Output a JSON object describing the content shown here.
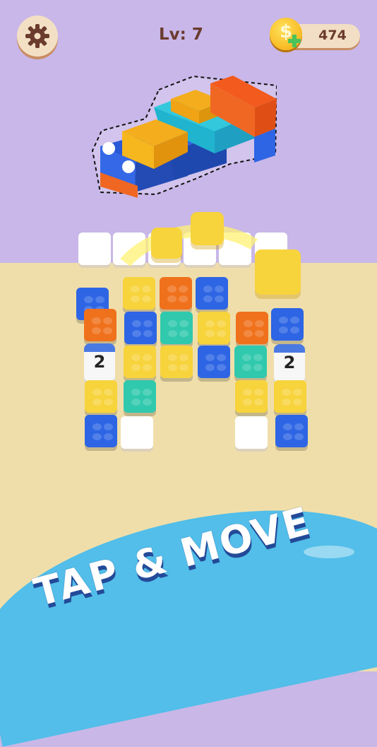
{
  "hud": {
    "settings_icon": "gear-icon",
    "level_text": "Lv: 7",
    "coin_symbol": "$",
    "coin_count": "474"
  },
  "game": {
    "slogan": "TAP & MOVE",
    "colors": {
      "blue": "#2d65e4",
      "orange": "#f0711c",
      "yellow": "#f7d33c",
      "teal": "#30c9ad",
      "white": "#ffffff"
    },
    "stack_numbers": [
      "2",
      "2"
    ]
  }
}
